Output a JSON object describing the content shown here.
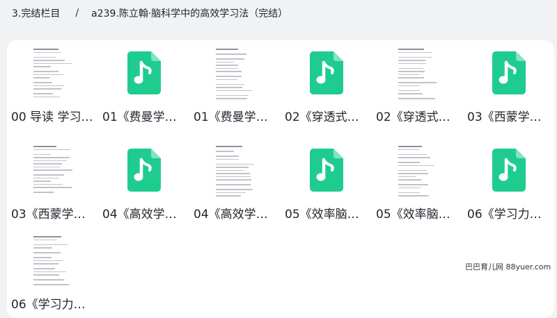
{
  "breadcrumb": {
    "parent": "3.完结栏目",
    "separator": "/",
    "current": "a239.陈立翰·脑科学中的高效学习法（完结）"
  },
  "files": [
    {
      "name": "00 导读 学习…",
      "kind": "document",
      "icon": "document-thumbnail"
    },
    {
      "name": "01《费曼学…",
      "kind": "audio",
      "icon": "audio-file-icon"
    },
    {
      "name": "01《费曼学…",
      "kind": "document",
      "icon": "document-thumbnail"
    },
    {
      "name": "02《穿透式…",
      "kind": "audio",
      "icon": "audio-file-icon"
    },
    {
      "name": "02《穿透式…",
      "kind": "document",
      "icon": "document-thumbnail"
    },
    {
      "name": "03《西蒙学…",
      "kind": "audio",
      "icon": "audio-file-icon"
    },
    {
      "name": "03《西蒙学…",
      "kind": "document",
      "icon": "document-thumbnail"
    },
    {
      "name": "04《高效学…",
      "kind": "audio",
      "icon": "audio-file-icon"
    },
    {
      "name": "04《高效学…",
      "kind": "document",
      "icon": "document-thumbnail"
    },
    {
      "name": "05《效率脑…",
      "kind": "audio",
      "icon": "audio-file-icon"
    },
    {
      "name": "05《效率脑…",
      "kind": "document",
      "icon": "document-thumbnail"
    },
    {
      "name": "06《学习力…",
      "kind": "audio",
      "icon": "audio-file-icon"
    },
    {
      "name": "06《学习力…",
      "kind": "document",
      "icon": "document-thumbnail"
    }
  ],
  "watermark": "巴巴育儿网 88yuer.com",
  "colors": {
    "audio_icon": "#1fcc8f",
    "panel_bg": "#ffffff",
    "page_bg": "#f1f2f4"
  }
}
